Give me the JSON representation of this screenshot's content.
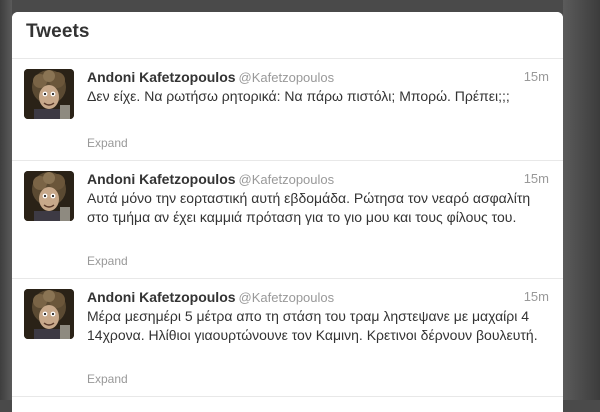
{
  "timeline": {
    "title": "Tweets",
    "tweets": [
      {
        "fullname": "Andoni Kafetzopoulos",
        "username": "@Kafetzopoulos",
        "time": "15m",
        "text": "Δεν είχε. Να ρωτήσω ρητορικά: Να πάρω πιστόλι; Μπορώ. Πρέπει;;;",
        "expand": "Expand"
      },
      {
        "fullname": "Andoni Kafetzopoulos",
        "username": "@Kafetzopoulos",
        "time": "15m",
        "text": "Αυτά μόνο την εορταστική αυτή εβδομάδα. Ρώτησα τον νεαρό ασφαλίτη στο τμήμα αν έχει καμμιά πρόταση για το γιο μου και τους φίλους του.",
        "expand": "Expand"
      },
      {
        "fullname": "Andoni Kafetzopoulos",
        "username": "@Kafetzopoulos",
        "time": "15m",
        "text": "Μέρα μεσημέρι 5 μέτρα απο τη στάση του τραμ ληστεψανε με μαχαίρι 4 14χρονα. Ηλίθιοι γιαουρτώνουνε τον Καμινη. Κρετινοι δέρνουν βουλευτή.",
        "expand": "Expand"
      }
    ]
  }
}
